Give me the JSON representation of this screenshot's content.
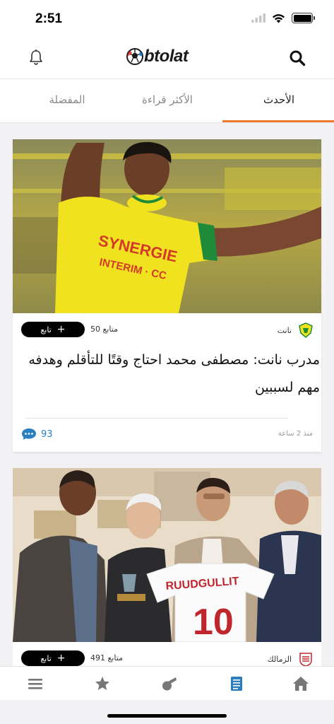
{
  "status": {
    "time": "2:51"
  },
  "header": {
    "logo_text": "btolat"
  },
  "tabs": [
    {
      "label": "الأحدث",
      "active": true
    },
    {
      "label": "الأكثر قراءة",
      "active": false
    },
    {
      "label": "المفضلة",
      "active": false
    }
  ],
  "articles": [
    {
      "team": "نانت",
      "followers": "50 متابع",
      "follow_label": "تابع",
      "headline": "مدرب نانت: مصطفى محمد احتاج وقتًا للتأقلم وهدفه مهم لسببين",
      "time_ago": "منذ 2 ساعة",
      "comments": "93"
    },
    {
      "team": "الزمالك",
      "followers": "491 متابع",
      "follow_label": "تابع",
      "jersey_name": "RUUDGULLIT",
      "jersey_number": "10"
    }
  ],
  "colors": {
    "accent": "#f07a2c",
    "link": "#2a7fc1",
    "nav_active": "#2a7fc1"
  },
  "bottom_nav": [
    "menu-icon",
    "star-icon",
    "whistle-icon",
    "news-icon",
    "home-icon"
  ]
}
